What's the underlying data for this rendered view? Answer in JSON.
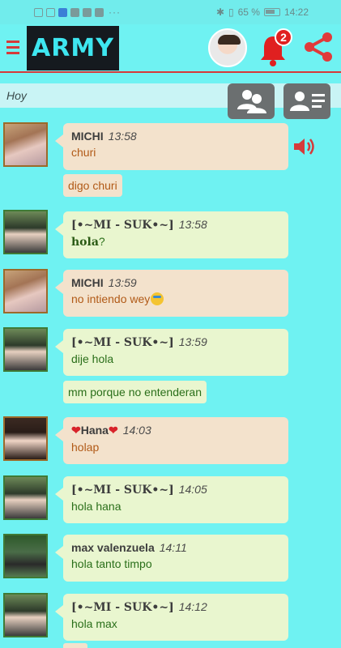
{
  "status_bar": {
    "battery": "65 %",
    "time": "14:22",
    "dots": "···"
  },
  "header": {
    "logo": "ARMY",
    "notifications_count": "2"
  },
  "day_bar": {
    "label": "Hoy"
  },
  "messages": [
    {
      "user": "MICHI",
      "time": "13:58",
      "text": "churi",
      "follow": "digo churi"
    },
    {
      "user": "[•~MI - SUK•~]",
      "time": "13:58",
      "text_bold": "hola",
      "text_rest": "?"
    },
    {
      "user": "MICHI",
      "time": "13:59",
      "text": "no intiendo wey"
    },
    {
      "user": "[•~MI - SUK•~]",
      "time": "13:59",
      "text": "dije hola",
      "follow": "mm porque no entenderan"
    },
    {
      "user": "Hana",
      "time": "14:03",
      "text": "holap"
    },
    {
      "user": "[•~MI - SUK•~]",
      "time": "14:05",
      "text": "hola hana"
    },
    {
      "user": "max valenzuela",
      "time": "14:11",
      "text": "hola tanto timpo"
    },
    {
      "user": "[•~MI - SUK•~]",
      "time": "14:12",
      "text": "hola max"
    }
  ],
  "icons": {
    "menu": "menu-icon",
    "bell": "bell-icon",
    "share": "share-icon",
    "group": "group-icon",
    "profile": "profile-list-icon",
    "speaker": "speaker-icon"
  },
  "colors": {
    "background": "#6ff2f2",
    "accent": "#d53a3a",
    "bubble_peach": "#f3e2cc",
    "bubble_green": "#e9f6cf"
  }
}
